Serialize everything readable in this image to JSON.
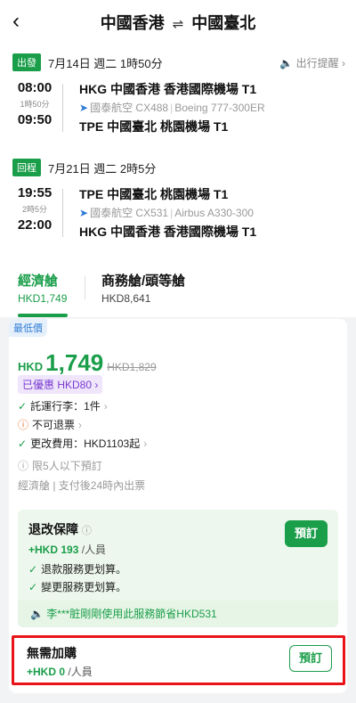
{
  "header": {
    "back_icon": "chevron-left-icon",
    "from": "中國香港",
    "swap": "⇌",
    "to": "中國臺北"
  },
  "outbound": {
    "badge": "出發",
    "date": "7月14日 週二 1時50分",
    "reminder": "出行提醒",
    "dep_time": "08:00",
    "duration": "1時50分",
    "arr_time": "09:50",
    "dep_airport": "HKG 中國香港 香港國際機場 T1",
    "airline": "國泰航空 CX488",
    "aircraft": "Boeing 777-300ER",
    "arr_airport": "TPE 中國臺北 桃園機場 T1"
  },
  "return": {
    "badge": "回程",
    "date": "7月21日 週二 2時5分",
    "dep_time": "19:55",
    "duration": "2時5分",
    "arr_time": "22:00",
    "dep_airport": "TPE 中國臺北 桃園機場 T1",
    "airline": "國泰航空 CX531",
    "aircraft": "Airbus A330-300",
    "arr_airport": "HKG 中國香港 香港國際機場 T1"
  },
  "tabs": [
    {
      "name": "經濟艙",
      "price": "HKD1,749"
    },
    {
      "name": "商務艙/頭等艙",
      "price": "HKD8,641"
    }
  ],
  "fare": {
    "lowest_badge": "最低價",
    "currency": "HKD",
    "price": "1,749",
    "old_price": "HKD1,829",
    "discount": "已優惠 HKD80 ›",
    "baggage": "託運行李：1件",
    "refund": "不可退票",
    "change": "更改費用：HKD1103起",
    "limit": "限5人以下預訂",
    "cabin_note": "經濟艙 | 支付後24時內出票"
  },
  "insurance": {
    "title": "退改保障",
    "price": "+HKD 193",
    "unit": "/人員",
    "item1": "退款服務更划算。",
    "item2": "變更服務更划算。",
    "book": "預訂",
    "notice": "李***脏剛剛使用此服務節省HKD531"
  },
  "no_addon": {
    "title": "無需加購",
    "price": "+HKD 0",
    "unit": "/人員",
    "book": "預訂"
  },
  "colors": {
    "accent": "#1a9e4a",
    "highlight": "#e8141a"
  }
}
